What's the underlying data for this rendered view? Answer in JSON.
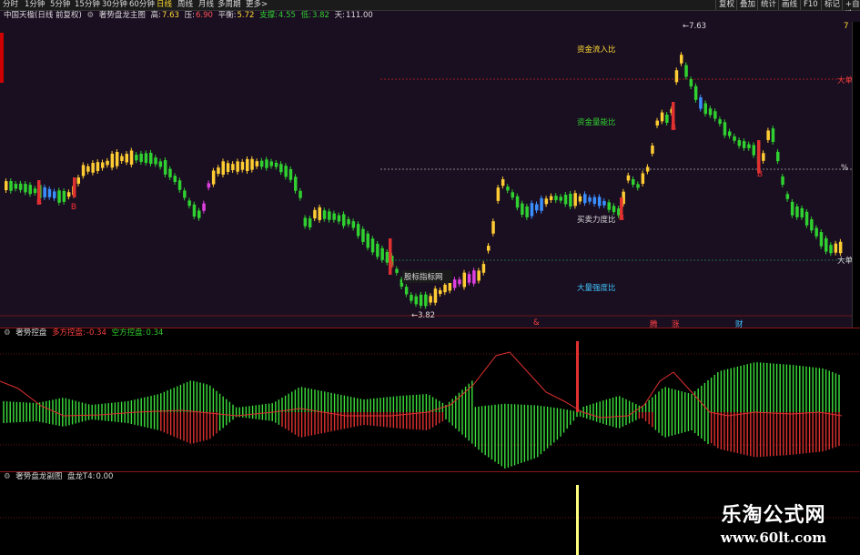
{
  "toolbar": {
    "periods": [
      "分时",
      "1分钟",
      "5分钟",
      "15分钟",
      "30分钟",
      "60分钟",
      "日线",
      "周线",
      "月线",
      "多周期",
      "更多>"
    ],
    "active_period": "日线",
    "tools": [
      "复权",
      "叠加",
      "统计",
      "画线",
      "F10",
      "标记",
      "+自选"
    ]
  },
  "main_header": {
    "stock": "中国天楹(日线 前复权)",
    "indicator": "奢势盘龙主图",
    "high_label": "高:",
    "high_val": "7.63",
    "press_label": "压:",
    "press_val": "6.90",
    "balance_label": "平衡:",
    "balance_val": "5.72",
    "support_label": "支撑:",
    "support_val": "4.55",
    "low_label": "低:",
    "low_val": "3.82",
    "sky_label": "天:",
    "sky_val": "111.00"
  },
  "main_labels": {
    "inflow": "资金流入比",
    "energy": "资金量能比",
    "buysell": "买卖力度比",
    "volume": "大量强度比",
    "big_top": "大单",
    "big_bot": "大单",
    "pct": "%",
    "hi_mark": "7.63",
    "lo_mark": "3.82",
    "tooltip": "股标指标网",
    "axis_7": "7",
    "b_mark": "B",
    "s_mark": "S",
    "bottom_markers": [
      "&",
      "腾",
      "涨",
      "财"
    ]
  },
  "sub_header": {
    "indicator": "奢势控盘",
    "long_label": "多方控盘:",
    "long_val": "-0.34",
    "short_label": "空方控盘:",
    "short_val": "0.34"
  },
  "bot_header": {
    "indicator": "奢势盘龙副图",
    "label": "盘龙T4:",
    "val": "0.00"
  },
  "watermark": {
    "line1": "乐淘公式网",
    "line2": "www.60lt.com"
  },
  "colors": {
    "up": "#ffcc33",
    "down": "#2fd02f",
    "blue": "#3a8fff",
    "magenta": "#e040e0",
    "red": "#e03030"
  }
}
